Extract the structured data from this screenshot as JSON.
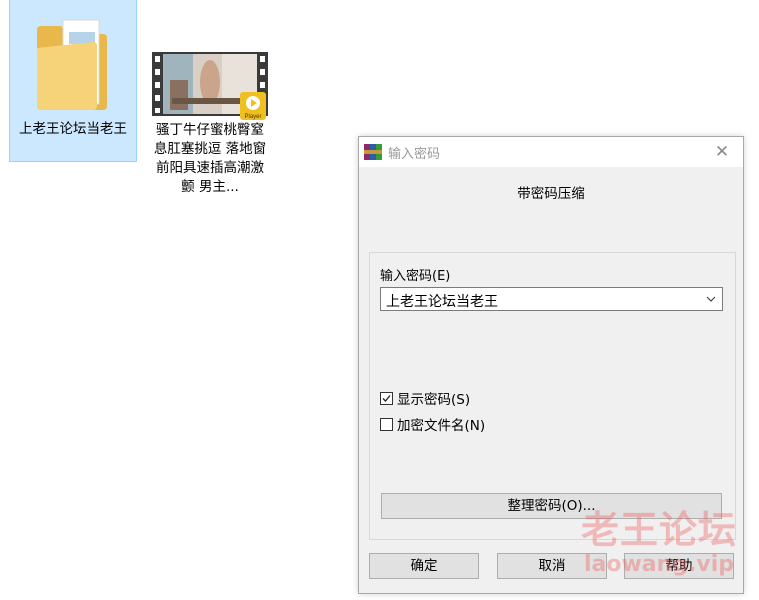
{
  "files": [
    {
      "name": "上老王论坛当老王",
      "type": "folder",
      "selected": true
    },
    {
      "name": "骚丁牛仔蜜桃臀窒息肛塞挑逗 落地窗前阳具速插高潮激颤 男主...",
      "type": "video",
      "badge": "Player"
    }
  ],
  "dialog": {
    "title": "输入密码",
    "heading": "带密码压缩",
    "password_label": "输入密码(E)",
    "password_value": "上老王论坛当老王",
    "show_password_label": "显示密码(S)",
    "show_password_checked": true,
    "encrypt_filenames_label": "加密文件名(N)",
    "encrypt_filenames_checked": false,
    "organize_button": "整理密码(O)...",
    "ok_button": "确定",
    "cancel_button": "取消",
    "help_button": "帮助",
    "close_symbol": "✕"
  },
  "watermark": {
    "text": "老王论坛",
    "url": "laowang.vip"
  },
  "colors": {
    "selection_bg": "#cce8ff",
    "selection_border": "#99d1ff",
    "dialog_bg": "#f0f0f0",
    "button_bg": "#e1e1e1",
    "watermark": "#f05f5f"
  }
}
